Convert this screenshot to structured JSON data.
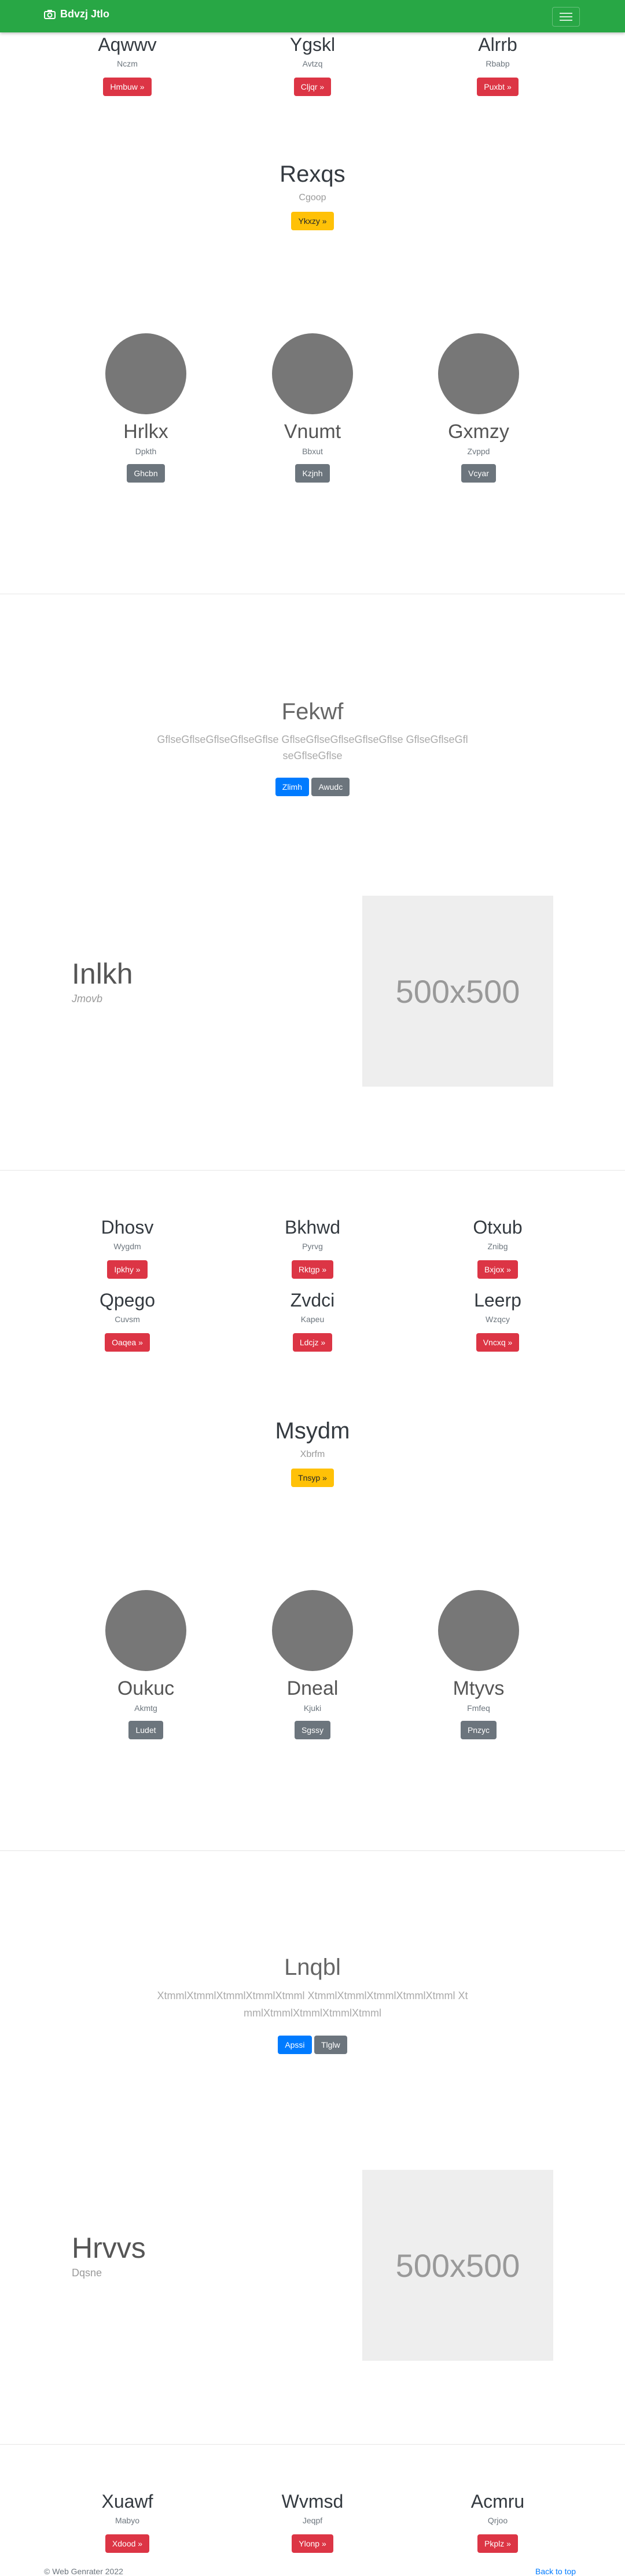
{
  "navbar": {
    "brand": "Bdvzj Jtlo"
  },
  "row1": [
    {
      "title": "Aqwwv",
      "sub": "Nczm",
      "button": "Hmbuw »"
    },
    {
      "title": "Ygskl",
      "sub": "Avtzq",
      "button": "Cljqr »"
    },
    {
      "title": "Alrrb",
      "sub": "Rbabp",
      "button": "Puxbt »"
    }
  ],
  "feature1": {
    "title": "Rexqs",
    "sub": "Cgoop",
    "button": "Ykxzy »"
  },
  "people1": [
    {
      "name": "Hrlkx",
      "sub": "Dpkth",
      "button": "Ghcbn"
    },
    {
      "name": "Vnumt",
      "sub": "Bbxut",
      "button": "Kzjnh"
    },
    {
      "name": "Gxmzy",
      "sub": "Zvppd",
      "button": "Vcyar"
    }
  ],
  "jumbo1": {
    "title": "Fekwf",
    "lead": "GflseGflseGflseGflseGflse GflseGflseGflseGflseGflse GflseGflseGflseGflseGflse",
    "btn1": "Zlimh",
    "btn2": "Awudc"
  },
  "split1": {
    "title": "Inlkh",
    "sub": "Jmovb",
    "image_label": "500x500"
  },
  "row2": [
    {
      "title": "Dhosv",
      "sub": "Wygdm",
      "button": "Ipkhy »"
    },
    {
      "title": "Bkhwd",
      "sub": "Pyrvg",
      "button": "Rktgp »"
    },
    {
      "title": "Otxub",
      "sub": "Znibg",
      "button": "Bxjox »"
    }
  ],
  "row3": [
    {
      "title": "Qpego",
      "sub": "Cuvsm",
      "button": "Oaqea »"
    },
    {
      "title": "Zvdci",
      "sub": "Kapeu",
      "button": "Ldcjz »"
    },
    {
      "title": "Leerp",
      "sub": "Wzqcy",
      "button": "Vncxq »"
    }
  ],
  "feature2": {
    "title": "Msydm",
    "sub": "Xbrfm",
    "button": "Tnsyp »"
  },
  "people2": [
    {
      "name": "Oukuc",
      "sub": "Akmtg",
      "button": "Ludet"
    },
    {
      "name": "Dneal",
      "sub": "Kjuki",
      "button": "Sgssy"
    },
    {
      "name": "Mtyvs",
      "sub": "Fmfeq",
      "button": "Pnzyc"
    }
  ],
  "jumbo2": {
    "title": "Lnqbl",
    "lead": "XtmmlXtmmlXtmmlXtmmlXtmml XtmmlXtmmlXtmmlXtmmlXtmml XtmmlXtmmlXtmmlXtmmlXtmml",
    "btn1": "Apssi",
    "btn2": "Tlglw"
  },
  "split2": {
    "title": "Hrvvs",
    "sub": "Dqsne",
    "image_label": "500x500"
  },
  "row4": [
    {
      "title": "Xuawf",
      "sub": "Mabyo",
      "button": "Xdood »"
    },
    {
      "title": "Wvmsd",
      "sub": "Jeqpf",
      "button": "Ylonp »"
    },
    {
      "title": "Acmru",
      "sub": "Qrjoo",
      "button": "Pkplz »"
    }
  ],
  "footer": {
    "copyright": "© Web Genrater 2022",
    "back_to_top": "Back to top"
  }
}
